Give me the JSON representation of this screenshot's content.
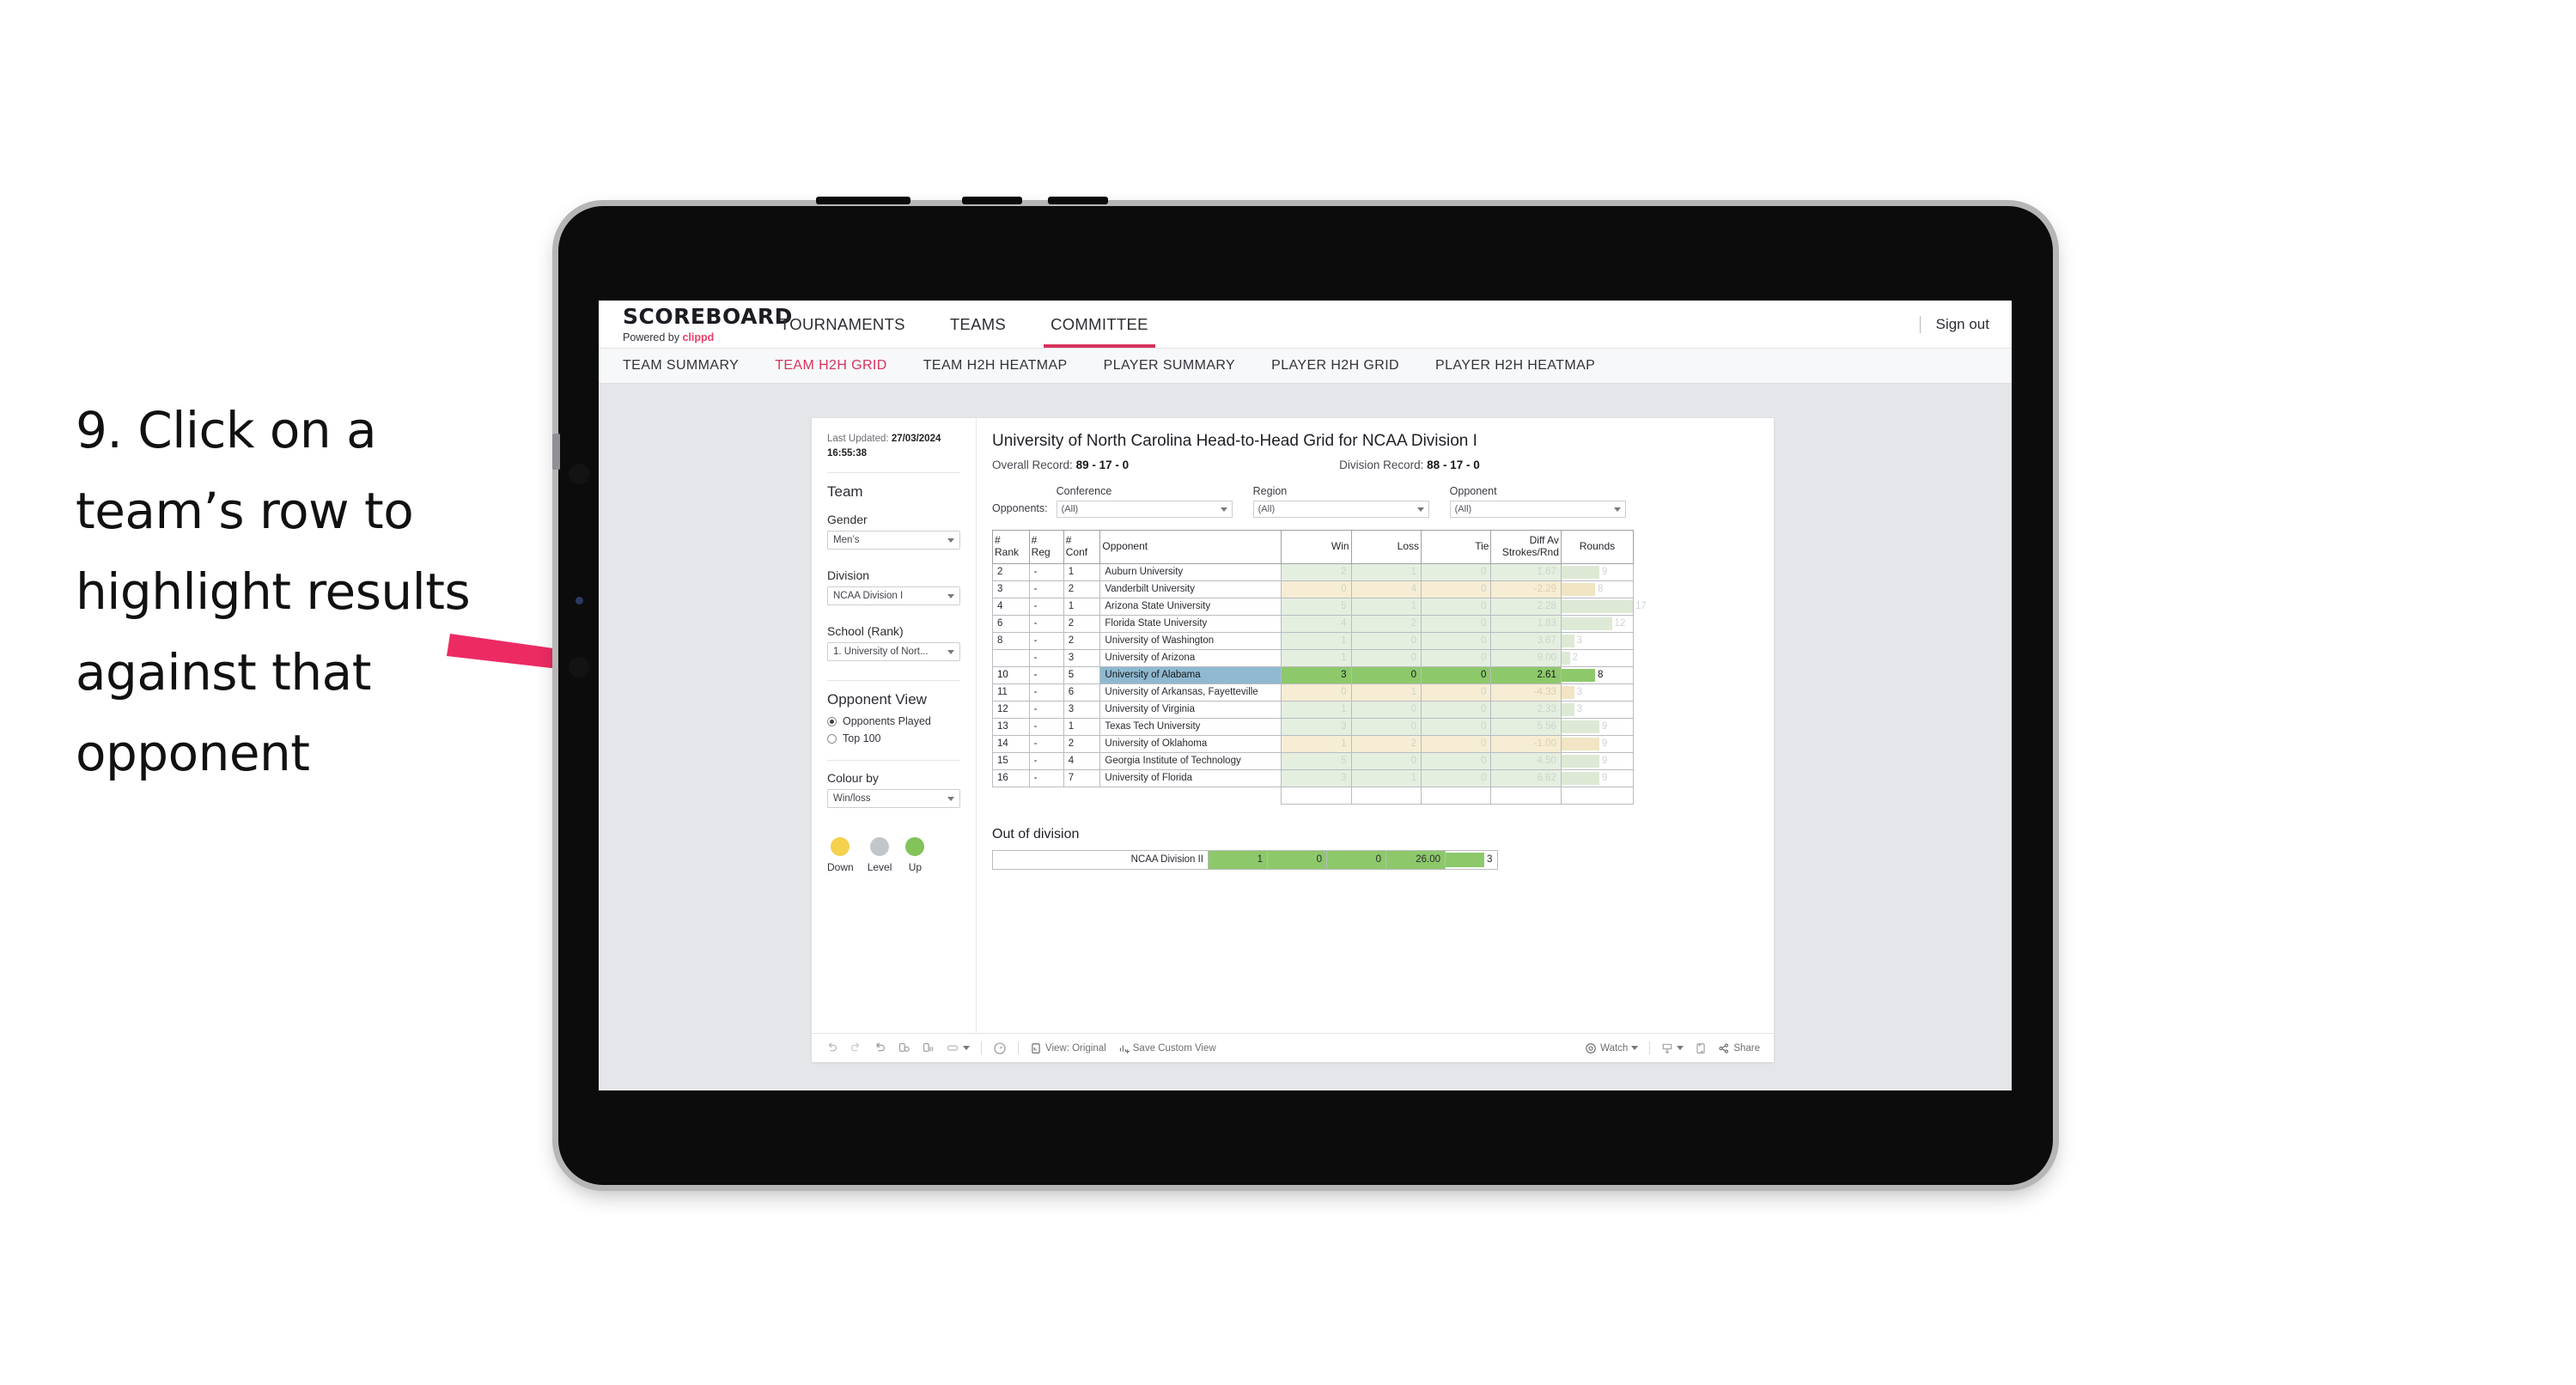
{
  "annotation": {
    "text": "9. Click on a team’s row to highlight results against that opponent",
    "arrow_color": "#ec2b63"
  },
  "app": {
    "brand": {
      "name": "SCOREBOARD",
      "powered_prefix": "Powered by ",
      "powered_by": "clippd"
    },
    "topnav": [
      {
        "label": "TOURNAMENTS",
        "active": false
      },
      {
        "label": "TEAMS",
        "active": false
      },
      {
        "label": "COMMITTEE",
        "active": true
      }
    ],
    "signout_label": "Sign out",
    "subnav": [
      {
        "label": "TEAM SUMMARY",
        "active": false
      },
      {
        "label": "TEAM H2H GRID",
        "active": true
      },
      {
        "label": "TEAM H2H HEATMAP",
        "active": false
      },
      {
        "label": "PLAYER SUMMARY",
        "active": false
      },
      {
        "label": "PLAYER H2H GRID",
        "active": false
      },
      {
        "label": "PLAYER H2H HEATMAP",
        "active": false
      }
    ],
    "accent_color": "#d6325b"
  },
  "sidebar": {
    "last_updated_label": "Last Updated:",
    "last_updated_value": "27/03/2024 16:55:38",
    "team_heading": "Team",
    "gender_label": "Gender",
    "gender_value": "Men’s",
    "division_label": "Division",
    "division_value": "NCAA Division I",
    "school_label": "School (Rank)",
    "school_value": "1. University of Nort...",
    "opponent_view_heading": "Opponent View",
    "opponent_view_options": [
      {
        "label": "Opponents Played",
        "selected": true
      },
      {
        "label": "Top 100",
        "selected": false
      }
    ],
    "colour_by_label": "Colour by",
    "colour_by_value": "Win/loss",
    "legend": [
      {
        "label": "Down",
        "color": "#f5d14e"
      },
      {
        "label": "Level",
        "color": "#c3c6c9"
      },
      {
        "label": "Up",
        "color": "#82c35a"
      }
    ]
  },
  "main": {
    "title": "University of North Carolina Head-to-Head Grid for NCAA Division I",
    "overall_record_label": "Overall Record:",
    "overall_record_value": "89 - 17 - 0",
    "division_record_label": "Division Record:",
    "division_record_value": "88 - 17 - 0",
    "opponents_label": "Opponents:",
    "filters": [
      {
        "label": "Conference",
        "value": "(All)"
      },
      {
        "label": "Region",
        "value": "(All)"
      },
      {
        "label": "Opponent",
        "value": "(All)"
      }
    ]
  },
  "chart_data": {
    "type": "table",
    "title": "University of North Carolina Head-to-Head Grid for NCAA Division I",
    "columns": [
      "# Rank",
      "# Reg",
      "# Conf",
      "Opponent",
      "Win",
      "Loss",
      "Tie",
      "Diff Av Strokes/Rnd",
      "Rounds"
    ],
    "colour_by": "Win/loss",
    "rounds_max": 17,
    "rows": [
      {
        "rank": "2",
        "reg": "-",
        "conf": "1",
        "opponent": "Auburn University",
        "win": "2",
        "loss": "1",
        "tie": "0",
        "diff": "1.67",
        "rounds": "9",
        "result": "up",
        "selected": false
      },
      {
        "rank": "3",
        "reg": "-",
        "conf": "2",
        "opponent": "Vanderbilt University",
        "win": "0",
        "loss": "4",
        "tie": "0",
        "diff": "-2.29",
        "rounds": "8",
        "result": "down",
        "selected": false
      },
      {
        "rank": "4",
        "reg": "-",
        "conf": "1",
        "opponent": "Arizona State University",
        "win": "5",
        "loss": "1",
        "tie": "0",
        "diff": "2.28",
        "rounds": "17",
        "result": "up",
        "selected": false
      },
      {
        "rank": "6",
        "reg": "-",
        "conf": "2",
        "opponent": "Florida State University",
        "win": "4",
        "loss": "2",
        "tie": "0",
        "diff": "1.83",
        "rounds": "12",
        "result": "up",
        "selected": false
      },
      {
        "rank": "8",
        "reg": "-",
        "conf": "2",
        "opponent": "University of Washington",
        "win": "1",
        "loss": "0",
        "tie": "0",
        "diff": "3.67",
        "rounds": "3",
        "result": "up",
        "selected": false
      },
      {
        "rank": "",
        "reg": "-",
        "conf": "3",
        "opponent": "University of Arizona",
        "win": "1",
        "loss": "0",
        "tie": "0",
        "diff": "9.00",
        "rounds": "2",
        "result": "up",
        "selected": false
      },
      {
        "rank": "10",
        "reg": "-",
        "conf": "5",
        "opponent": "University of Alabama",
        "win": "3",
        "loss": "0",
        "tie": "0",
        "diff": "2.61",
        "rounds": "8",
        "result": "up",
        "selected": true
      },
      {
        "rank": "11",
        "reg": "-",
        "conf": "6",
        "opponent": "University of Arkansas, Fayetteville",
        "win": "0",
        "loss": "1",
        "tie": "0",
        "diff": "-4.33",
        "rounds": "3",
        "result": "down",
        "selected": false
      },
      {
        "rank": "12",
        "reg": "-",
        "conf": "3",
        "opponent": "University of Virginia",
        "win": "1",
        "loss": "0",
        "tie": "0",
        "diff": "2.33",
        "rounds": "3",
        "result": "up",
        "selected": false
      },
      {
        "rank": "13",
        "reg": "-",
        "conf": "1",
        "opponent": "Texas Tech University",
        "win": "3",
        "loss": "0",
        "tie": "0",
        "diff": "5.56",
        "rounds": "9",
        "result": "up",
        "selected": false
      },
      {
        "rank": "14",
        "reg": "-",
        "conf": "2",
        "opponent": "University of Oklahoma",
        "win": "1",
        "loss": "2",
        "tie": "0",
        "diff": "-1.00",
        "rounds": "9",
        "result": "down",
        "selected": false
      },
      {
        "rank": "15",
        "reg": "-",
        "conf": "4",
        "opponent": "Georgia Institute of Technology",
        "win": "5",
        "loss": "0",
        "tie": "0",
        "diff": "4.50",
        "rounds": "9",
        "result": "up",
        "selected": false
      },
      {
        "rank": "16",
        "reg": "-",
        "conf": "7",
        "opponent": "University of Florida",
        "win": "3",
        "loss": "1",
        "tie": "0",
        "diff": "6.62",
        "rounds": "9",
        "result": "up",
        "selected": false
      }
    ],
    "out_of_division": {
      "title": "Out of division",
      "label": "NCAA Division II",
      "win": "1",
      "loss": "0",
      "tie": "0",
      "diff": "26.00",
      "rounds": "3"
    }
  },
  "toolbar": {
    "view_label": "View: Original",
    "save_label": "Save Custom View",
    "watch_label": "Watch",
    "share_label": "Share"
  }
}
